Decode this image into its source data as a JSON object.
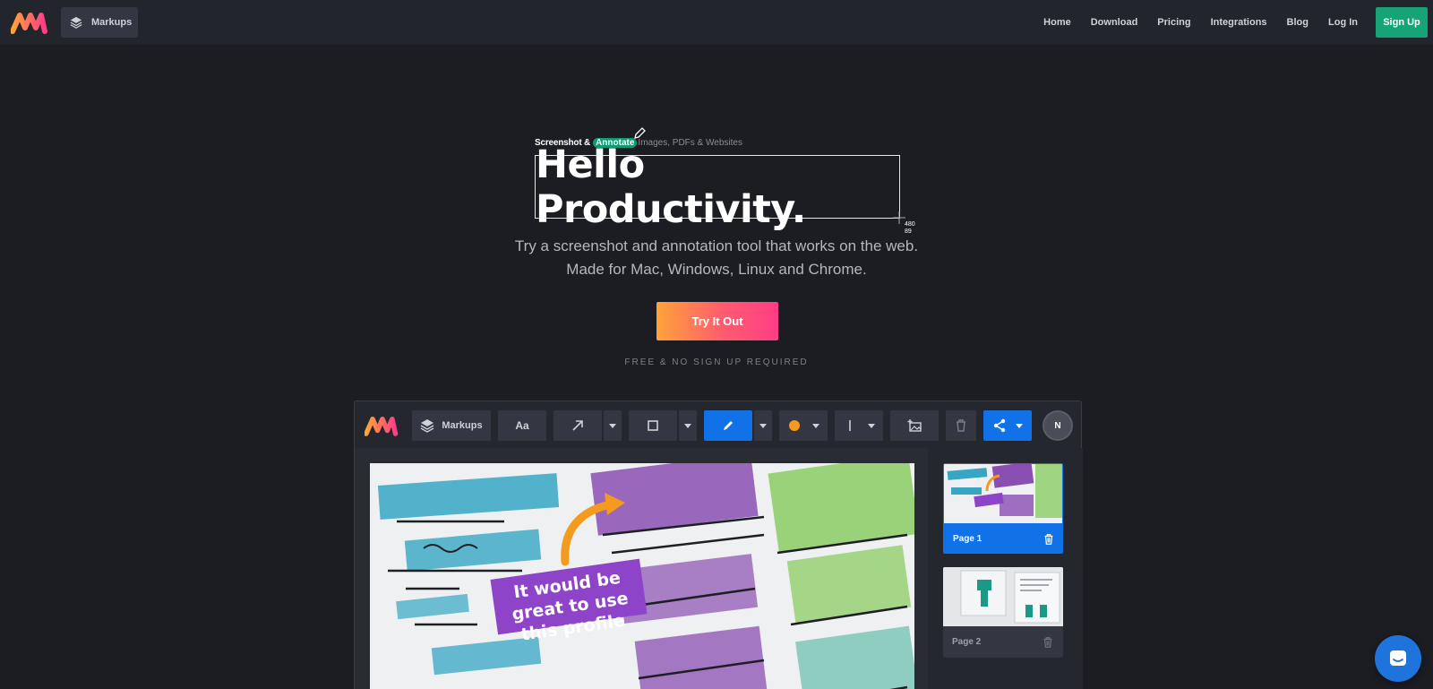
{
  "topbar": {
    "markups_label": "Markups",
    "nav": [
      "Home",
      "Download",
      "Pricing",
      "Integrations",
      "Blog",
      "Log In"
    ],
    "signup_label": "Sign Up"
  },
  "hero": {
    "kicker_strong": "Screenshot &",
    "kicker_highlight": "Annotate",
    "kicker_rest": "Images, PDFs & Websites",
    "headline": "Hello Productivity.",
    "dimension_readout": [
      "480",
      "89"
    ],
    "subtitle": "Try a screenshot and annotation tool that works on the web. Made for Mac, Windows, Linux and Chrome.",
    "cta_label": "Try It Out",
    "free_note": "FREE & NO SIGN UP REQUIRED"
  },
  "app": {
    "markups_label": "Markups",
    "text_tool_label": "Aa",
    "avatar_initial": "N",
    "annotation_text": "It would be great to use this profile",
    "pages": [
      {
        "label": "Page 1"
      },
      {
        "label": "Page 2"
      }
    ]
  },
  "colors": {
    "accent_green": "#16a376",
    "accent_blue": "#1072e6",
    "annotation_purple": "#8e44c9",
    "arrow_orange": "#f39a1f"
  }
}
